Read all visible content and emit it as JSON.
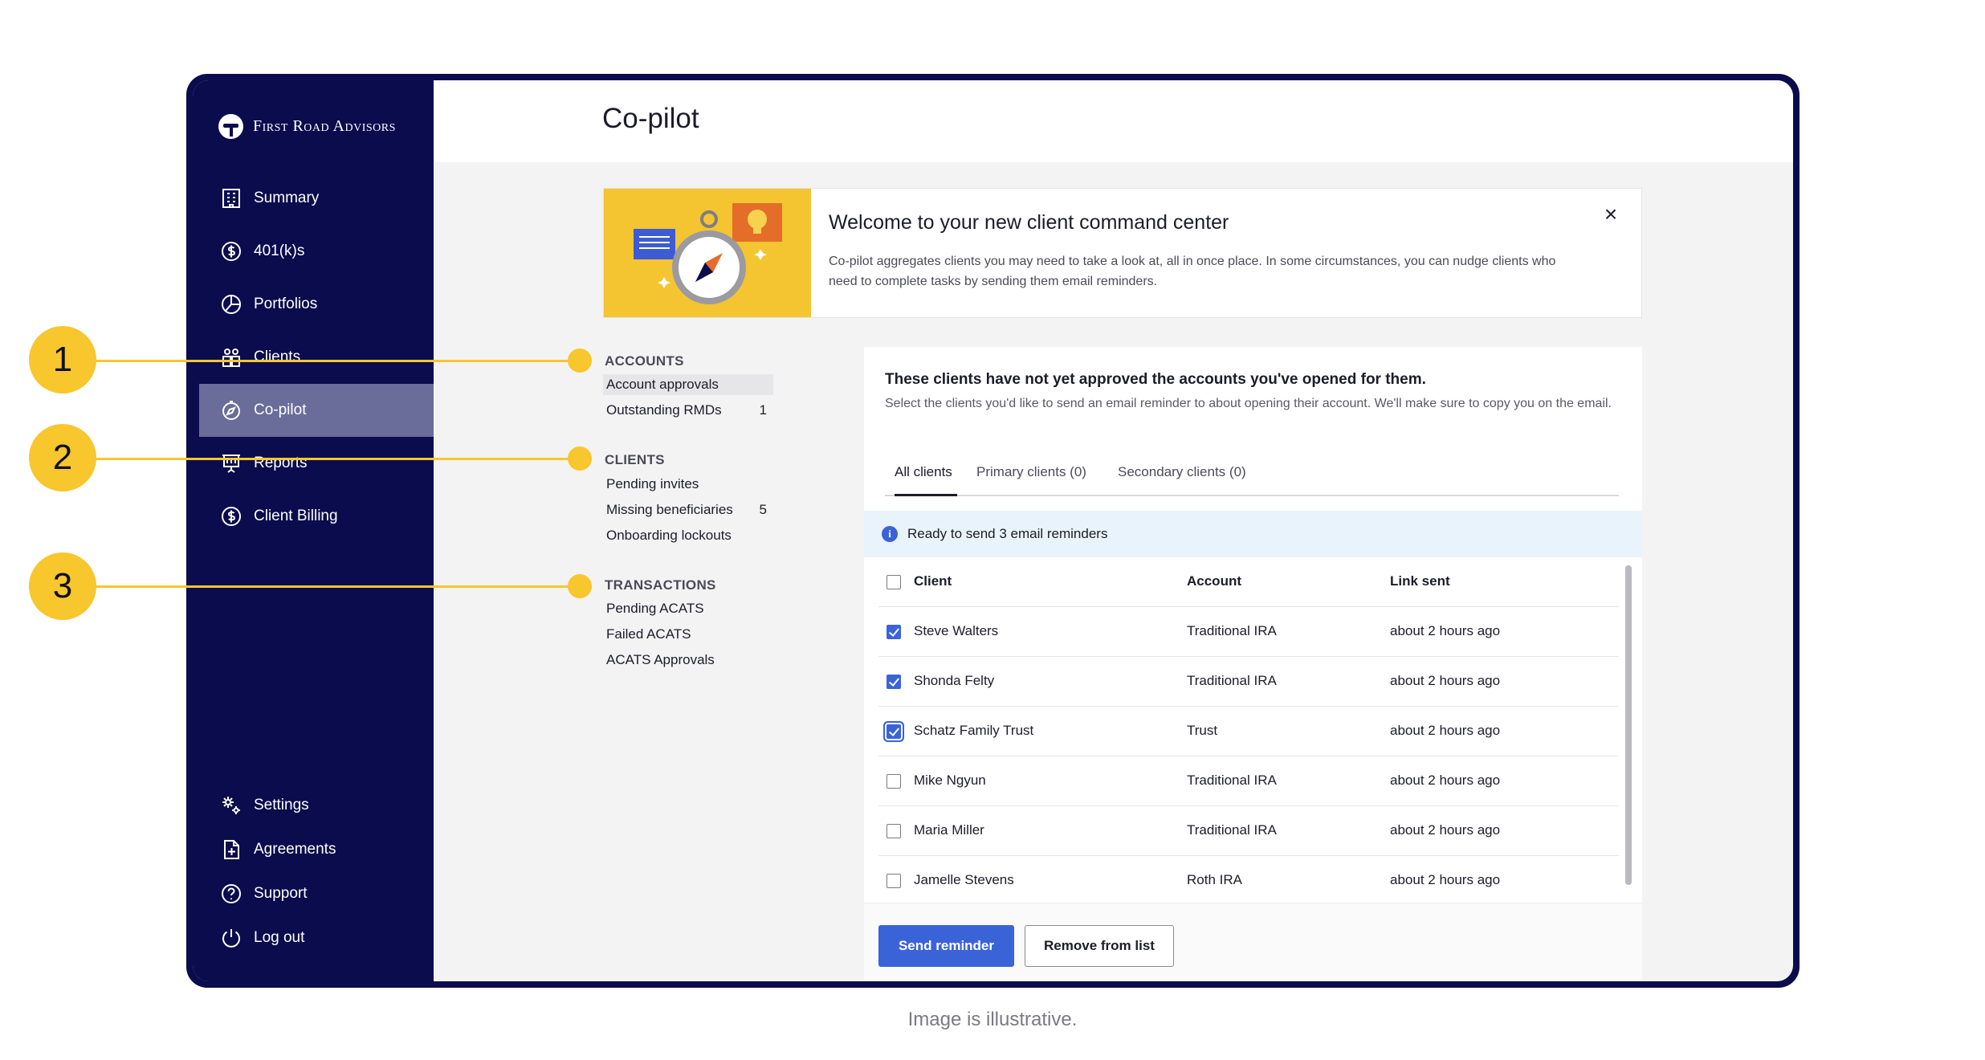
{
  "brand": {
    "name": "First Road Advisors"
  },
  "sidebar": {
    "items": [
      {
        "label": "Summary",
        "icon": "building-icon"
      },
      {
        "label": "401(k)s",
        "icon": "dollar-circle-icon"
      },
      {
        "label": "Portfolios",
        "icon": "pie-chart-icon"
      },
      {
        "label": "Clients",
        "icon": "people-icon"
      },
      {
        "label": "Co-pilot",
        "icon": "compass-icon",
        "active": true
      },
      {
        "label": "Reports",
        "icon": "presentation-chart-icon"
      },
      {
        "label": "Client Billing",
        "icon": "dollar-circle-icon"
      }
    ],
    "bottom_items": [
      {
        "label": "Settings",
        "icon": "gears-icon"
      },
      {
        "label": "Agreements",
        "icon": "document-plus-icon"
      },
      {
        "label": "Support",
        "icon": "question-circle-icon"
      },
      {
        "label": "Log out",
        "icon": "power-icon"
      }
    ]
  },
  "header": {
    "title": "Co-pilot"
  },
  "banner": {
    "title": "Welcome to your new client command center",
    "description": "Co-pilot aggregates clients you may need to take a look at, all in once place. In some circumstances, you can nudge clients who need to complete tasks by sending them email reminders.",
    "close_label": "×"
  },
  "categories": [
    {
      "heading": "ACCOUNTS",
      "items": [
        {
          "label": "Account approvals",
          "count": "",
          "selected": true
        },
        {
          "label": "Outstanding RMDs",
          "count": "1"
        }
      ]
    },
    {
      "heading": "CLIENTS",
      "items": [
        {
          "label": "Pending invites",
          "count": ""
        },
        {
          "label": "Missing beneficiaries",
          "count": "5"
        },
        {
          "label": "Onboarding lockouts",
          "count": ""
        }
      ]
    },
    {
      "heading": "TRANSACTIONS",
      "items": [
        {
          "label": "Pending ACATS",
          "count": ""
        },
        {
          "label": "Failed ACATS",
          "count": ""
        },
        {
          "label": "ACATS Approvals",
          "count": ""
        }
      ]
    }
  ],
  "panel": {
    "heading": "These clients have not yet approved the accounts you've opened for them.",
    "subtext": "Select the clients you'd like to send an email reminder to about opening their account. We'll make sure to copy you on the email.",
    "tabs": [
      "All clients",
      "Primary clients (0)",
      "Secondary clients (0)"
    ],
    "info": "Ready to send 3 email reminders",
    "columns": [
      "Client",
      "Account",
      "Link sent"
    ],
    "rows": [
      {
        "client": "Steve Walters",
        "account": "Traditional IRA",
        "link_sent": "about 2 hours ago",
        "checked": true
      },
      {
        "client": "Shonda Felty",
        "account": "Traditional IRA",
        "link_sent": "about 2 hours ago",
        "checked": true
      },
      {
        "client": "Schatz Family Trust",
        "account": "Trust",
        "link_sent": "about 2 hours ago",
        "checked": true,
        "focused": true
      },
      {
        "client": "Mike Ngyun",
        "account": "Traditional IRA",
        "link_sent": "about 2 hours ago",
        "checked": false
      },
      {
        "client": "Maria Miller",
        "account": "Traditional IRA",
        "link_sent": "about 2 hours ago",
        "checked": false
      },
      {
        "client": "Jamelle Stevens",
        "account": "Roth IRA",
        "link_sent": "about 2 hours ago",
        "checked": false
      }
    ],
    "send_button": "Send reminder",
    "remove_button": "Remove from list"
  },
  "callouts": [
    "1",
    "2",
    "3"
  ],
  "caption": "Image is illustrative.",
  "colors": {
    "navy": "#0b0c4d",
    "accent_blue": "#3b63d8",
    "callout_yellow": "#f8c62d",
    "active_nav": "#6a6c99",
    "banner_yellow": "#f4c431"
  }
}
